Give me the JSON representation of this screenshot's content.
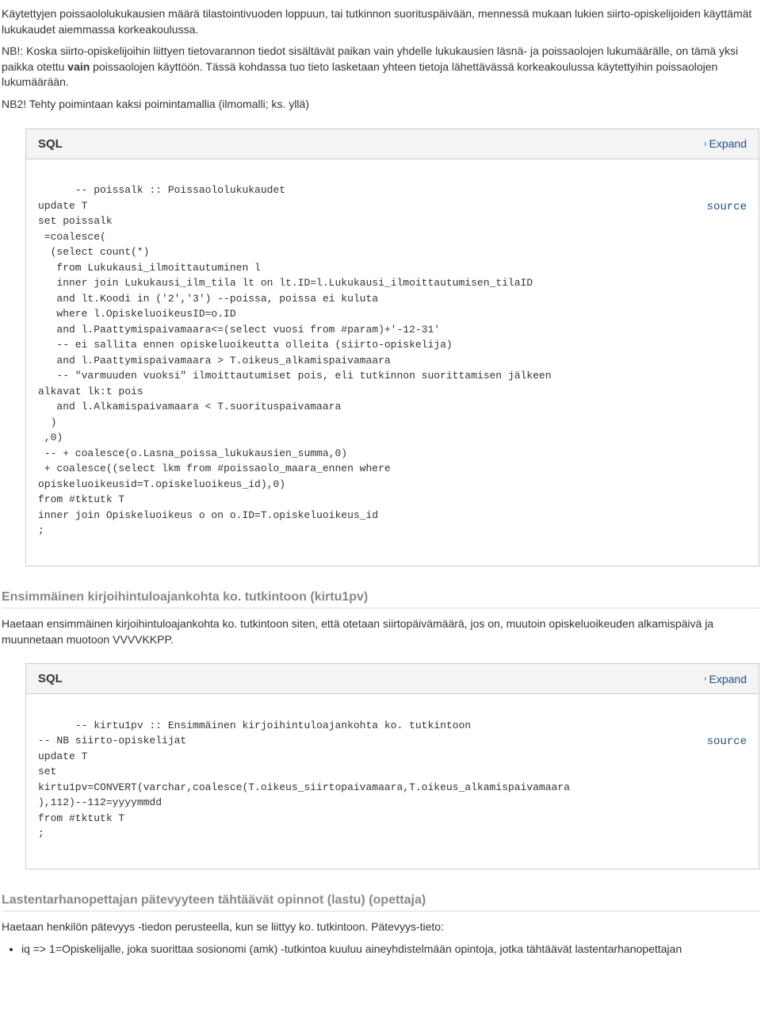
{
  "intro": {
    "p1": "Käytettyjen poissaololukukausien määrä tilastointivuoden loppuun, tai tutkinnon suorituspäivään, mennessä mukaan lukien siirto-opiskelijoiden käyttämät lukukaudet aiemmassa korkeakoulussa.",
    "p2_prefix": "NB!: Koska siirto-opiskelijoihin liittyen tietovarannon tiedot sisältävät paikan vain yhdelle lukukausien läsnä- ja poissaolojen lukumäärälle, on tämä yksi paikka otettu ",
    "p2_bold": "vain",
    "p2_suffix": " poissaolojen käyttöön. Tässä kohdassa tuo tieto lasketaan yhteen tietoja lähettävässä korkeakoulussa käytettyihin poissaolojen lukumäärään.",
    "p3": "NB2! Tehty poimintaan kaksi poimintamallia (ilmomalli; ks. yllä)"
  },
  "panel1": {
    "title": "SQL",
    "expand": "Expand",
    "source": "source",
    "code": "-- poissalk :: Poissaololukukaudet\nupdate T\nset poissalk\n =coalesce(\n  (select count(*)\n   from Lukukausi_ilmoittautuminen l\n   inner join Lukukausi_ilm_tila lt on lt.ID=l.Lukukausi_ilmoittautumisen_tilaID\n   and lt.Koodi in ('2','3') --poissa, poissa ei kuluta\n   where l.OpiskeluoikeusID=o.ID\n   and l.Paattymispaivamaara<=(select vuosi from #param)+'-12-31'\n   -- ei sallita ennen opiskeluoikeutta olleita (siirto-opiskelija)\n   and l.Paattymispaivamaara > T.oikeus_alkamispaivamaara\n   -- \"varmuuden vuoksi\" ilmoittautumiset pois, eli tutkinnon suorittamisen jälkeen\nalkavat lk:t pois\n   and l.Alkamispaivamaara < T.suorituspaivamaara\n  )\n ,0)\n -- + coalesce(o.Lasna_poissa_lukukausien_summa,0)\n + coalesce((select lkm from #poissaolo_maara_ennen where\nopiskeluoikeusid=T.opiskeluoikeus_id),0)\nfrom #tktutk T\ninner join Opiskeluoikeus o on o.ID=T.opiskeluoikeus_id\n;"
  },
  "section2": {
    "heading": "Ensimmäinen kirjoihintuloajankohta ko. tutkintoon (kirtu1pv)",
    "p1": "Haetaan ensimmäinen kirjoihintuloajankohta ko. tutkintoon siten, että otetaan siirtopäivämäärä, jos on, muutoin opiskeluoikeuden alkamispäivä ja muunnetaan muotoon VVVVKKPP."
  },
  "panel2": {
    "title": "SQL",
    "expand": "Expand",
    "source": "source",
    "code": "-- kirtu1pv :: Ensimmäinen kirjoihintuloajankohta ko. tutkintoon\n-- NB siirto-opiskelijat\nupdate T\nset\nkirtu1pv=CONVERT(varchar,coalesce(T.oikeus_siirtopaivamaara,T.oikeus_alkamispaivamaara\n),112)--112=yyyymmdd\nfrom #tktutk T\n;"
  },
  "section3": {
    "heading": "Lastentarhanopettajan pätevyyteen tähtäävät opinnot (lastu) (opettaja)",
    "p1": "Haetaan henkilön pätevyys -tiedon perusteella, kun se liittyy ko. tutkintoon. Pätevyys-tieto:",
    "bullet1": "iq => 1=Opiskelijalle, joka suorittaa sosionomi (amk) -tutkintoa kuuluu aineyhdistelmään opintoja, jotka tähtäävät lastentarhanopettajan"
  }
}
